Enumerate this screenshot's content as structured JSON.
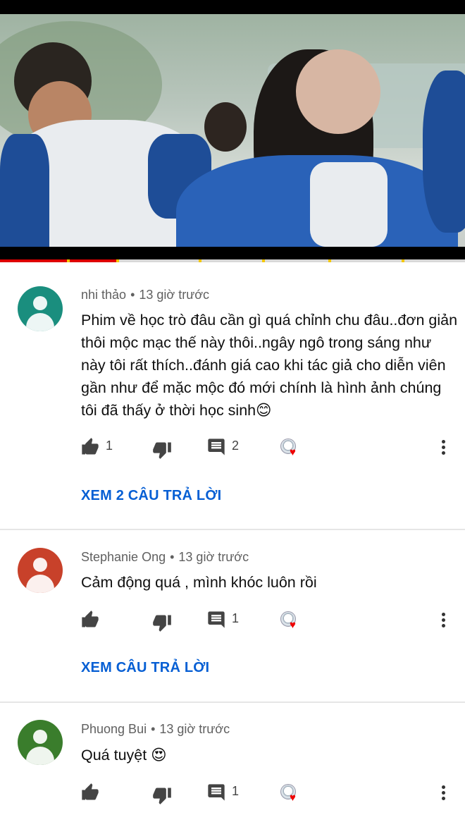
{
  "comments": [
    {
      "author": "nhi thảo",
      "time": "13 giờ trước",
      "text": "Phim về học trò đâu cần gì quá chỉnh chu đâu..đơn giản thôi mộc mạc thế này thôi..ngây ngô trong sáng như này tôi rất thích..đánh giá cao khi tác giả cho diễn viên gần như để mặc mộc đó mới chính là hình ảnh chúng tôi đã thấy ở thời học sinh😊",
      "likes": "1",
      "replies": "2",
      "reply_link": "XEM 2 CÂU TRẢ LỜI",
      "avatar_color": "#1a8e7e"
    },
    {
      "author": "Stephanie Ong",
      "time": "13 giờ trước",
      "text": "Cảm động quá , mình khóc luôn rồi",
      "likes": "",
      "replies": "1",
      "reply_link": "XEM CÂU TRẢ LỜI",
      "avatar_color": "#c8412a"
    },
    {
      "author": "Phuong Bui",
      "time": "13 giờ trước",
      "text": "Quá tuyệt 😍",
      "likes": "",
      "replies": "1",
      "reply_link": "",
      "avatar_color": "#3a7d2c"
    }
  ],
  "meta_separator": "•",
  "icons": {
    "like": "thumbs-up-icon",
    "dislike": "thumbs-down-icon",
    "reply": "comment-icon",
    "creator_heart": "creator-heart-icon",
    "more": "more-vertical-icon"
  },
  "colors": {
    "link": "#065fd4",
    "progress_played": "#dd0000",
    "progress_marker": "#f2c600"
  },
  "video": {
    "progress_fraction": 0.25
  }
}
